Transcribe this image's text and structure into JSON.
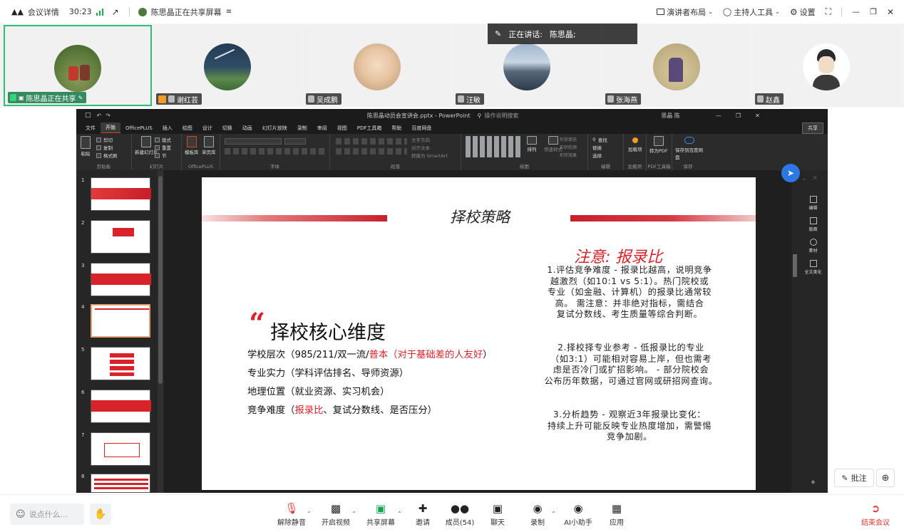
{
  "topbar": {
    "meeting_details": "会议详情",
    "timer": "30:23",
    "sharing_status": "陈思晶正在共享屏幕",
    "layout": "演讲者布局",
    "host_tools": "主持人工具",
    "settings": "设置"
  },
  "speaking": {
    "label": "正在讲话:",
    "name": "陈思晶;"
  },
  "participants": [
    {
      "name": "陈思晶正在共享"
    },
    {
      "name": "谢红芸"
    },
    {
      "name": "吴成鹏"
    },
    {
      "name": "汪敏"
    },
    {
      "name": "张海燕"
    },
    {
      "name": "赵鑫"
    }
  ],
  "ppt": {
    "window_title": "陈思晶动员会宣讲会.pptx - PowerPoint",
    "search_hint": "操作说明搜索",
    "user": "思晶 陈",
    "share_btn": "共享",
    "tabs": [
      "文件",
      "开始",
      "OfficePLUS",
      "插入",
      "绘图",
      "设计",
      "切换",
      "动画",
      "幻灯片放映",
      "录制",
      "审阅",
      "视图",
      "PDF工具箱",
      "帮助",
      "百度网盘"
    ],
    "ribbon": {
      "paste": "粘贴",
      "cut": "剪切",
      "copy": "复制",
      "format_painter": "格式刷",
      "clipboard": "剪贴板",
      "new_slide": "新建幻灯片",
      "layout": "版式",
      "reset": "重置",
      "section": "节",
      "slides": "幻灯片",
      "template_lib": "模板库",
      "single_page": "单页库",
      "officeplus": "OfficePLUS",
      "font": "字体",
      "paragraph": "段落",
      "text_direction": "文字方向",
      "align_text": "对齐文本",
      "smartart": "转换为 SmartArt",
      "arrange": "排列",
      "quick_styles": "快速样式",
      "shape_fill": "形状填充",
      "shape_outline": "形状轮廓",
      "shape_effects": "形状效果",
      "drawing": "绘图",
      "find": "查找",
      "replace": "替换",
      "select": "选择",
      "editing": "编辑",
      "addin": "加载项",
      "addin_grp": "加载项",
      "to_pdf": "转为PDF",
      "pdf_tools": "PDF工具箱",
      "save_baidu": "保存到百度网盘",
      "save": "保存"
    },
    "side_pane": [
      "编辑",
      "版面",
      "素材",
      "全文美化"
    ],
    "slide_numbers": [
      "1",
      "2",
      "3",
      "4",
      "5",
      "6",
      "7",
      "8"
    ]
  },
  "slide": {
    "title": "择校策略",
    "quote_mark": "“",
    "heading": "择校核心维度",
    "items": [
      {
        "pre": "学校层次（985/211/双一流/",
        "red": "普本（对于基础差的人友好",
        "post": "）"
      },
      {
        "pre": "专业实力（学科评估排名、导师资源）",
        "red": "",
        "post": ""
      },
      {
        "pre": "地理位置（就业资源、实习机会）",
        "red": "",
        "post": ""
      },
      {
        "pre": "竞争难度（",
        "red": "报录比",
        "post": "、复试分数线、是否压分）"
      }
    ],
    "note_red": "注意:",
    "note_black": " 报录比",
    "para1": [
      "1.评估竞争难度  - 报录比越高，说明竞争",
      "越激烈（如10:1 vs 5:1）。热门院校或",
      "专业（如金融、计算机）的报录比通常较",
      "高。     需注意：并非绝对指标，需结合",
      "复试分数线、考生质量等综合判断。"
    ],
    "para2": [
      "2.择校择专业参考    - 低报录比的专业",
      "（如3:1）可能相对容易上岸，但也需考",
      "虑是否冷门或扩招影响。   - 部分院校会",
      "公布历年数据，可通过官网或研招网查询。"
    ],
    "para3": [
      "3.分析趋势    - 观察近3年报录比变化：",
      "持续上升可能反映专业热度增加，需警惕",
      "竞争加剧。"
    ]
  },
  "annotate": "批注",
  "bottombar": {
    "say_placeholder": "说点什么...",
    "unmute": "解除静音",
    "start_video": "开启视频",
    "share_screen": "共享屏幕",
    "invite": "邀请",
    "members": "成员(54)",
    "chat": "聊天",
    "record": "录制",
    "ai_assistant": "AI小助手",
    "apps": "应用",
    "leave": "结束会议"
  },
  "colors": {
    "accent_green": "#2fbd78",
    "slide_red": "#d8232a",
    "leave_red": "#e0332d"
  }
}
